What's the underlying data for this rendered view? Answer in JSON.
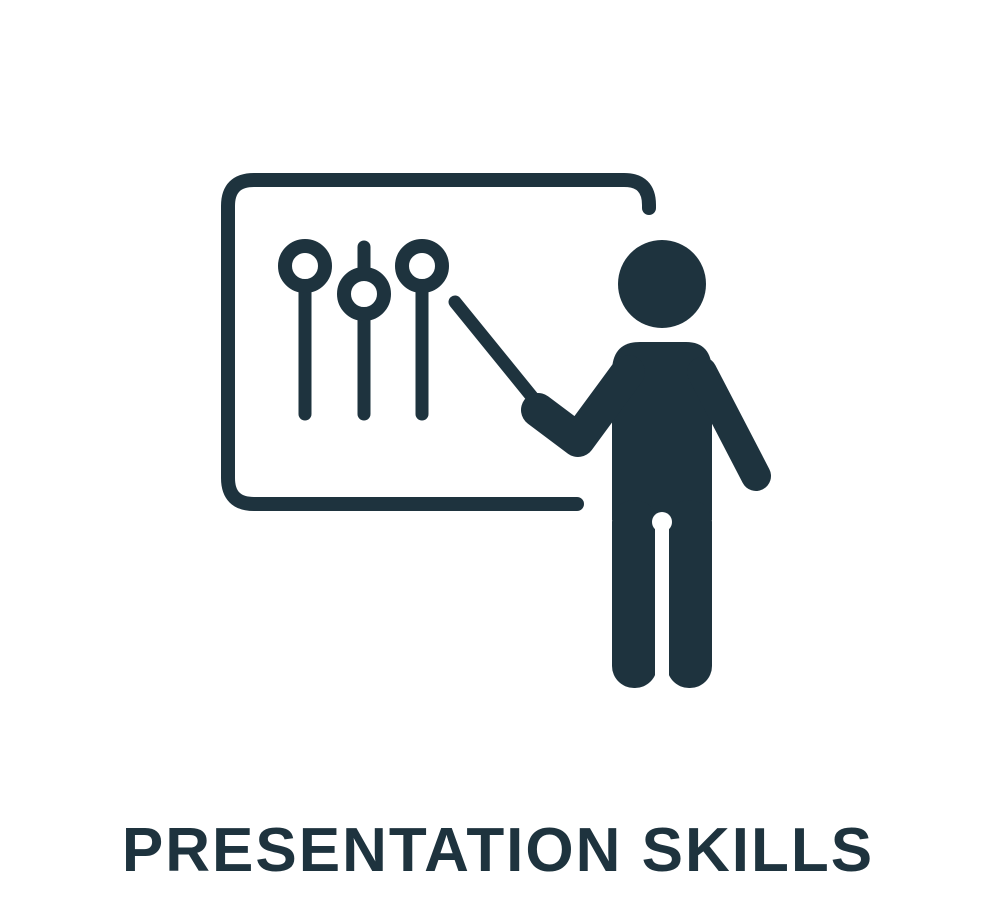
{
  "caption": "PRESENTATION SKILLS",
  "colors": {
    "ink": "#1e333e",
    "background": "#ffffff"
  },
  "icon": "presentation-skills-icon"
}
